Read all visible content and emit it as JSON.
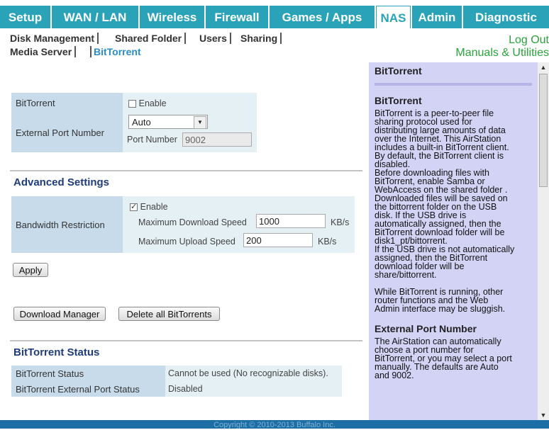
{
  "nav": {
    "tabs": [
      "Setup",
      "WAN / LAN",
      "Wireless",
      "Firewall",
      "Games / Apps",
      "NAS",
      "Admin",
      "Diagnostic"
    ],
    "active": "NAS"
  },
  "subnav": {
    "row1": [
      "Disk Management",
      "Shared Folder",
      "Users",
      "Sharing"
    ],
    "row2": [
      "Media Server",
      "BitTorrent"
    ],
    "active": "BitTorrent",
    "logout": "Log Out",
    "manuals": "Manuals & Utilities"
  },
  "bittorrent": {
    "label": "BitTorrent",
    "enable_label": "Enable",
    "enabled": false,
    "ext_port_label": "External Port Number",
    "port_mode": "Auto",
    "port_number_label": "Port Number",
    "port_number": "9002"
  },
  "advanced": {
    "title": "Advanced Settings",
    "bandwidth_label": "Bandwidth Restriction",
    "enable_label": "Enable",
    "enabled": true,
    "max_download_label": "Maximum Download Speed",
    "max_download": "1000",
    "download_unit": "KB/s",
    "max_upload_label": "Maximum Upload Speed",
    "max_upload": "200",
    "upload_unit": "KB/s"
  },
  "buttons": {
    "apply": "Apply",
    "download_manager": "Download Manager",
    "delete_all": "Delete all BitTorrents"
  },
  "status": {
    "title": "BitTorrent Status",
    "rows": [
      {
        "label": "BitTorrent Status",
        "value": "Cannot be used (No recognizable disks)."
      },
      {
        "label": "BitTorrent External Port Status",
        "value": "Disabled"
      }
    ]
  },
  "help": {
    "title": "BitTorrent",
    "heading1": "BitTorrent",
    "text1": "BitTorrent is a peer-to-peer file\nsharing protocol used for\ndistributing large amounts of data\nover the Internet. This AirStation\nincludes a built-in BitTorrent client.\nBy default, the BitTorrent client is\ndisabled.\nBefore downloading files with\nBitTorrent, enable Samba or\nWebAccess on the shared folder .\nDownloaded files will be saved on\nthe bittorrent folder on the USB\ndisk. If the USB drive is\nautomatically assigned, then the\nBitTorrent download folder will be\ndisk1_pt/bittorrent.\nIf the USB drive is not automatically\nassigned, then the BitTorrent\ndownload folder will be\nshare/bittorrent.\n\nWhile BitTorrent is running, other\nrouter functions and the Web\nAdmin interface may be sluggish.",
    "heading2": "External Port Number",
    "text2": "The AirStation can automatically\nchoose a port number for\nBitTorrent, or you may select a port\nmanually. The defaults are Auto\nand 9002."
  },
  "footer": "Copyright © 2010-2013 Buffalo Inc."
}
